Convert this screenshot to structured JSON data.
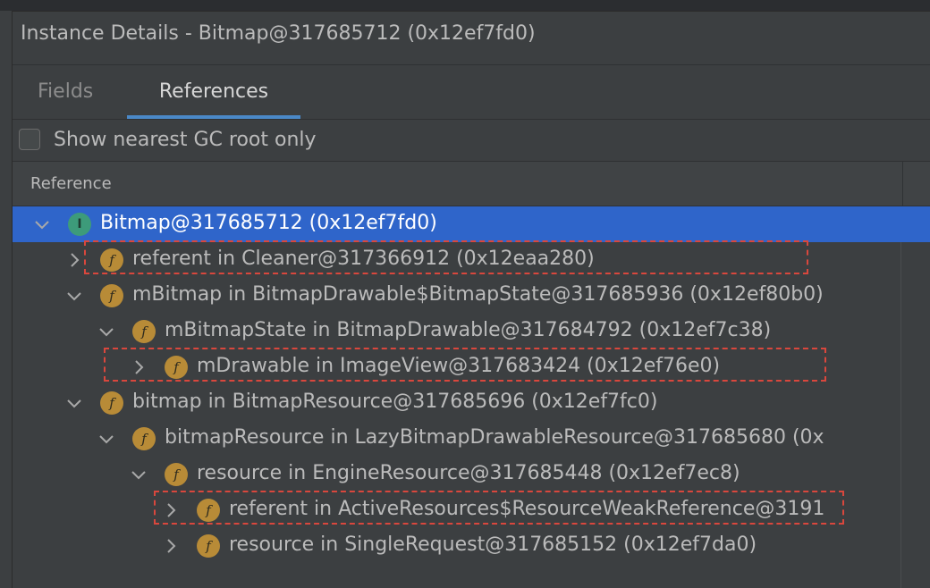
{
  "panel": {
    "title": "Instance Details - Bitmap@317685712 (0x12ef7fd0)",
    "tabs": [
      {
        "label": "Fields",
        "active": false
      },
      {
        "label": "References",
        "active": true
      }
    ],
    "gc_root_checkbox": {
      "label": "Show nearest GC root only",
      "checked": false
    },
    "column_header": "Reference"
  },
  "tree": {
    "rows": [
      {
        "text": "Bitmap@317685712 (0x12ef7fd0)",
        "icon": "instance-i-icon",
        "expanded": true,
        "selected": true
      },
      {
        "text": "referent in Cleaner@317366912 (0x12eaa280)",
        "icon": "field-f-icon",
        "expanded": false,
        "highlighted": true
      },
      {
        "text": "mBitmap in BitmapDrawable$BitmapState@317685936 (0x12ef80b0)",
        "icon": "field-f-icon",
        "expanded": true
      },
      {
        "text": "mBitmapState in BitmapDrawable@317684792 (0x12ef7c38)",
        "icon": "field-f-icon",
        "expanded": true
      },
      {
        "text": "mDrawable in ImageView@317683424 (0x12ef76e0)",
        "icon": "field-f-icon",
        "expanded": false,
        "highlighted": true
      },
      {
        "text": "bitmap in BitmapResource@317685696 (0x12ef7fc0)",
        "icon": "field-f-icon",
        "expanded": true
      },
      {
        "text": "bitmapResource in LazyBitmapDrawableResource@317685680 (0x",
        "icon": "field-f-icon",
        "expanded": true
      },
      {
        "text": "resource in EngineResource@317685448 (0x12ef7ec8)",
        "icon": "field-f-icon",
        "expanded": true
      },
      {
        "text": "referent in ActiveResources$ResourceWeakReference@3191",
        "icon": "field-f-icon",
        "expanded": false,
        "highlighted": true
      },
      {
        "text": "resource in SingleRequest@317685152 (0x12ef7da0)",
        "icon": "field-f-icon",
        "expanded": false
      }
    ]
  },
  "colors": {
    "selection": "#2f65ca",
    "highlight_box": "#d9473d",
    "field_badge": "#b88b37",
    "instance_badge": "#3d9b7a",
    "tab_underline": "#4a88c7"
  }
}
